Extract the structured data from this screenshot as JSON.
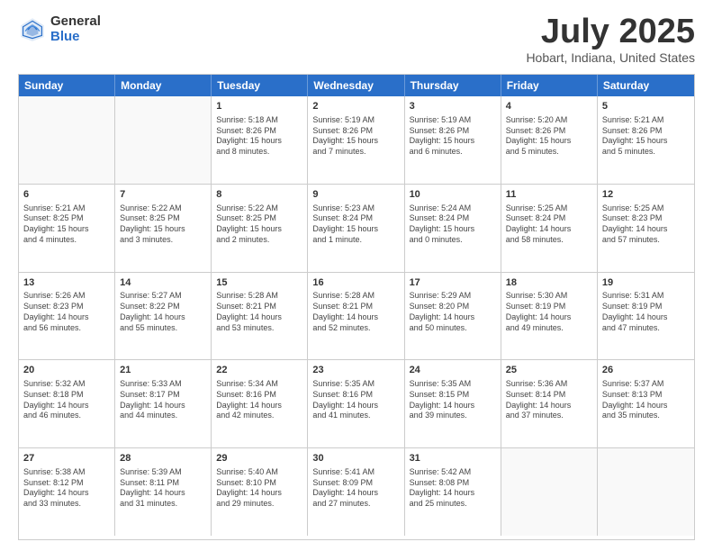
{
  "logo": {
    "general": "General",
    "blue": "Blue"
  },
  "title": "July 2025",
  "location": "Hobart, Indiana, United States",
  "header_days": [
    "Sunday",
    "Monday",
    "Tuesday",
    "Wednesday",
    "Thursday",
    "Friday",
    "Saturday"
  ],
  "weeks": [
    [
      {
        "day": "",
        "info": ""
      },
      {
        "day": "",
        "info": ""
      },
      {
        "day": "1",
        "info": "Sunrise: 5:18 AM\nSunset: 8:26 PM\nDaylight: 15 hours\nand 8 minutes."
      },
      {
        "day": "2",
        "info": "Sunrise: 5:19 AM\nSunset: 8:26 PM\nDaylight: 15 hours\nand 7 minutes."
      },
      {
        "day": "3",
        "info": "Sunrise: 5:19 AM\nSunset: 8:26 PM\nDaylight: 15 hours\nand 6 minutes."
      },
      {
        "day": "4",
        "info": "Sunrise: 5:20 AM\nSunset: 8:26 PM\nDaylight: 15 hours\nand 5 minutes."
      },
      {
        "day": "5",
        "info": "Sunrise: 5:21 AM\nSunset: 8:26 PM\nDaylight: 15 hours\nand 5 minutes."
      }
    ],
    [
      {
        "day": "6",
        "info": "Sunrise: 5:21 AM\nSunset: 8:25 PM\nDaylight: 15 hours\nand 4 minutes."
      },
      {
        "day": "7",
        "info": "Sunrise: 5:22 AM\nSunset: 8:25 PM\nDaylight: 15 hours\nand 3 minutes."
      },
      {
        "day": "8",
        "info": "Sunrise: 5:22 AM\nSunset: 8:25 PM\nDaylight: 15 hours\nand 2 minutes."
      },
      {
        "day": "9",
        "info": "Sunrise: 5:23 AM\nSunset: 8:24 PM\nDaylight: 15 hours\nand 1 minute."
      },
      {
        "day": "10",
        "info": "Sunrise: 5:24 AM\nSunset: 8:24 PM\nDaylight: 15 hours\nand 0 minutes."
      },
      {
        "day": "11",
        "info": "Sunrise: 5:25 AM\nSunset: 8:24 PM\nDaylight: 14 hours\nand 58 minutes."
      },
      {
        "day": "12",
        "info": "Sunrise: 5:25 AM\nSunset: 8:23 PM\nDaylight: 14 hours\nand 57 minutes."
      }
    ],
    [
      {
        "day": "13",
        "info": "Sunrise: 5:26 AM\nSunset: 8:23 PM\nDaylight: 14 hours\nand 56 minutes."
      },
      {
        "day": "14",
        "info": "Sunrise: 5:27 AM\nSunset: 8:22 PM\nDaylight: 14 hours\nand 55 minutes."
      },
      {
        "day": "15",
        "info": "Sunrise: 5:28 AM\nSunset: 8:21 PM\nDaylight: 14 hours\nand 53 minutes."
      },
      {
        "day": "16",
        "info": "Sunrise: 5:28 AM\nSunset: 8:21 PM\nDaylight: 14 hours\nand 52 minutes."
      },
      {
        "day": "17",
        "info": "Sunrise: 5:29 AM\nSunset: 8:20 PM\nDaylight: 14 hours\nand 50 minutes."
      },
      {
        "day": "18",
        "info": "Sunrise: 5:30 AM\nSunset: 8:19 PM\nDaylight: 14 hours\nand 49 minutes."
      },
      {
        "day": "19",
        "info": "Sunrise: 5:31 AM\nSunset: 8:19 PM\nDaylight: 14 hours\nand 47 minutes."
      }
    ],
    [
      {
        "day": "20",
        "info": "Sunrise: 5:32 AM\nSunset: 8:18 PM\nDaylight: 14 hours\nand 46 minutes."
      },
      {
        "day": "21",
        "info": "Sunrise: 5:33 AM\nSunset: 8:17 PM\nDaylight: 14 hours\nand 44 minutes."
      },
      {
        "day": "22",
        "info": "Sunrise: 5:34 AM\nSunset: 8:16 PM\nDaylight: 14 hours\nand 42 minutes."
      },
      {
        "day": "23",
        "info": "Sunrise: 5:35 AM\nSunset: 8:16 PM\nDaylight: 14 hours\nand 41 minutes."
      },
      {
        "day": "24",
        "info": "Sunrise: 5:35 AM\nSunset: 8:15 PM\nDaylight: 14 hours\nand 39 minutes."
      },
      {
        "day": "25",
        "info": "Sunrise: 5:36 AM\nSunset: 8:14 PM\nDaylight: 14 hours\nand 37 minutes."
      },
      {
        "day": "26",
        "info": "Sunrise: 5:37 AM\nSunset: 8:13 PM\nDaylight: 14 hours\nand 35 minutes."
      }
    ],
    [
      {
        "day": "27",
        "info": "Sunrise: 5:38 AM\nSunset: 8:12 PM\nDaylight: 14 hours\nand 33 minutes."
      },
      {
        "day": "28",
        "info": "Sunrise: 5:39 AM\nSunset: 8:11 PM\nDaylight: 14 hours\nand 31 minutes."
      },
      {
        "day": "29",
        "info": "Sunrise: 5:40 AM\nSunset: 8:10 PM\nDaylight: 14 hours\nand 29 minutes."
      },
      {
        "day": "30",
        "info": "Sunrise: 5:41 AM\nSunset: 8:09 PM\nDaylight: 14 hours\nand 27 minutes."
      },
      {
        "day": "31",
        "info": "Sunrise: 5:42 AM\nSunset: 8:08 PM\nDaylight: 14 hours\nand 25 minutes."
      },
      {
        "day": "",
        "info": ""
      },
      {
        "day": "",
        "info": ""
      }
    ]
  ]
}
